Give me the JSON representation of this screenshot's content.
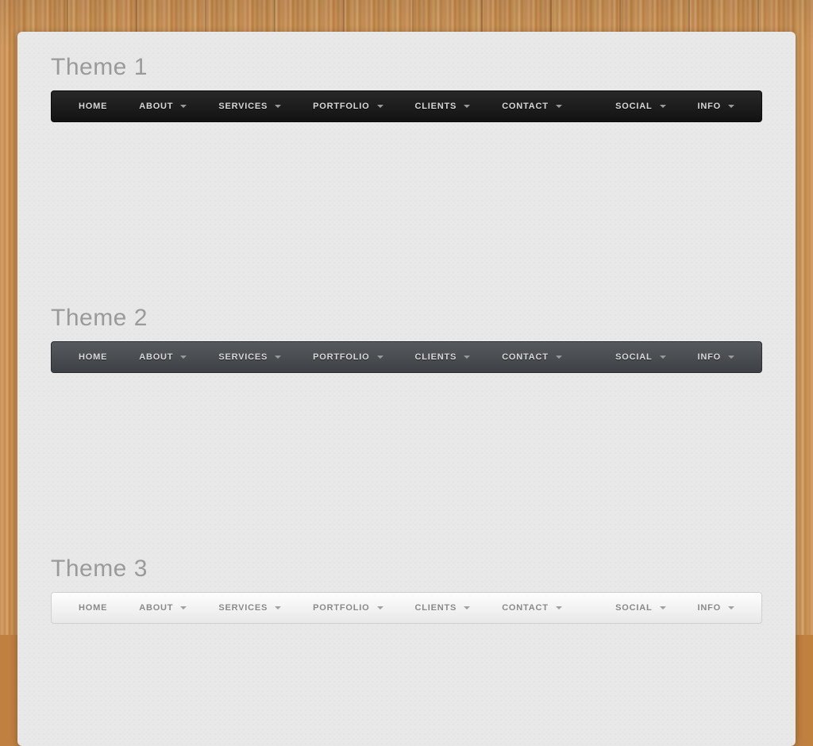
{
  "themes": [
    {
      "title": "Theme 1",
      "variant": "dark"
    },
    {
      "title": "Theme 2",
      "variant": "slate"
    },
    {
      "title": "Theme 3",
      "variant": "light"
    }
  ],
  "nav_left": [
    {
      "id": "home",
      "label": "HOME",
      "dropdown": false
    },
    {
      "id": "about",
      "label": "ABOUT",
      "dropdown": true
    },
    {
      "id": "services",
      "label": "SERVICES",
      "dropdown": true
    },
    {
      "id": "portfolio",
      "label": "PORTFOLIO",
      "dropdown": true
    },
    {
      "id": "clients",
      "label": "CLIENTS",
      "dropdown": true
    },
    {
      "id": "contact",
      "label": "CONTACT",
      "dropdown": true
    }
  ],
  "nav_right": [
    {
      "id": "social",
      "label": "SOCIAL",
      "dropdown": true
    },
    {
      "id": "info",
      "label": "INFO",
      "dropdown": true
    }
  ]
}
